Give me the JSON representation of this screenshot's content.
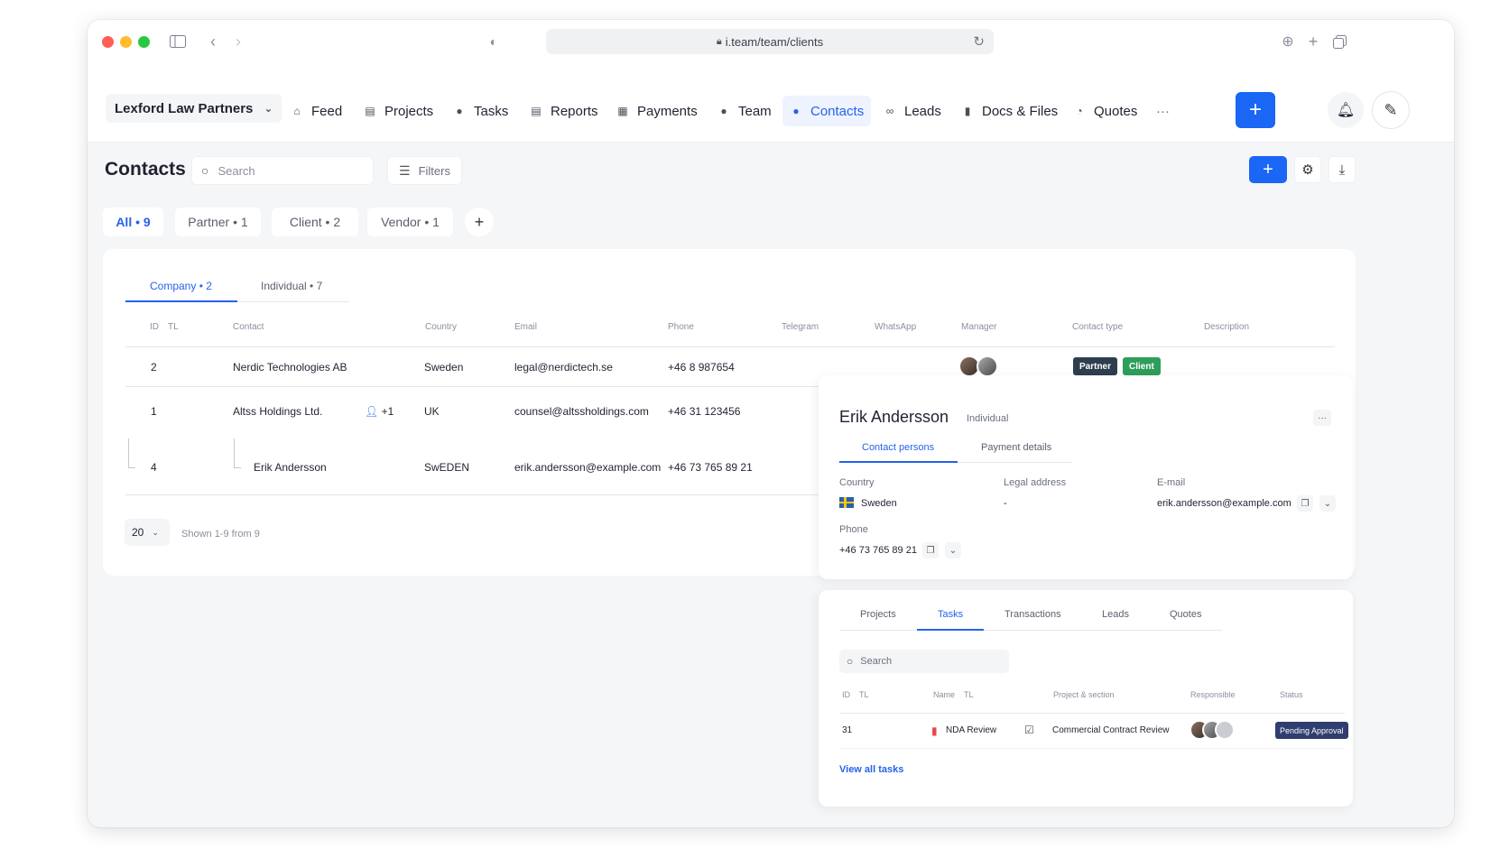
{
  "browser": {
    "url": "i.team/team/clients"
  },
  "org": {
    "name": "Lexford Law Partners"
  },
  "nav": [
    {
      "label": "Feed",
      "icon": "home-icon"
    },
    {
      "label": "Projects",
      "icon": "document-icon"
    },
    {
      "label": "Tasks",
      "icon": "check-circle-icon"
    },
    {
      "label": "Reports",
      "icon": "report-icon"
    },
    {
      "label": "Payments",
      "icon": "wallet-icon"
    },
    {
      "label": "Team",
      "icon": "user-icon"
    },
    {
      "label": "Contacts",
      "icon": "contacts-icon",
      "active": true
    },
    {
      "label": "Leads",
      "icon": "link-icon"
    },
    {
      "label": "Docs & Files",
      "icon": "folder-icon"
    },
    {
      "label": "Quotes",
      "icon": "quote-icon"
    }
  ],
  "nav_more": "···",
  "page": {
    "title": "Contacts",
    "search_placeholder": "Search",
    "filters_label": "Filters"
  },
  "pills": [
    {
      "label": "All • 9",
      "active": true
    },
    {
      "label": "Partner • 1"
    },
    {
      "label": "Client • 2"
    },
    {
      "label": "Vendor • 1"
    }
  ],
  "subtabs": [
    {
      "label": "Company • 2",
      "active": true
    },
    {
      "label": "Individual • 7"
    }
  ],
  "table": {
    "headers": {
      "id": "ID",
      "tl": "TL",
      "contact": "Contact",
      "country": "Country",
      "email": "Email",
      "phone": "Phone",
      "telegram": "Telegram",
      "whatsapp": "WhatsApp",
      "manager": "Manager",
      "contact_type": "Contact type",
      "description": "Description"
    },
    "rows": [
      {
        "id": "2",
        "contact": "Nerdic Technologies AB",
        "country": "Sweden",
        "email": "legal@nerdictech.se",
        "phone": "+46 8 987654",
        "types": [
          "Partner",
          "Client"
        ]
      },
      {
        "id": "1",
        "contact": "Altss Holdings Ltd.",
        "persons": "+1",
        "country": "UK",
        "email": "counsel@altssholdings.com",
        "phone": "+46 31 123456"
      },
      {
        "id": "4",
        "contact": "Erik Andersson",
        "country": "SwEDEN",
        "email": "erik.andersson@example.com",
        "phone": "+46 73 765 89 21"
      }
    ]
  },
  "pager": {
    "per_page": "20",
    "shown": "Shown 1-9 from 9"
  },
  "colors": {
    "accent": "#1a66f5",
    "partner": "#2f3e4e",
    "client": "#2e9e5b",
    "status": "#2f3e6e"
  },
  "detail": {
    "name": "Erik Andersson",
    "type": "Individual",
    "more": "···",
    "tabs": [
      {
        "label": "Contact persons",
        "active": true
      },
      {
        "label": "Payment details"
      }
    ],
    "country_label": "Country",
    "country": "Sweden",
    "legal_label": "Legal address",
    "legal": "-",
    "email_label": "E-mail",
    "email": "erik.andersson@example.com",
    "phone_label": "Phone",
    "phone": "+46 73 765 89 21"
  },
  "tasks": {
    "tabs": [
      {
        "label": "Projects"
      },
      {
        "label": "Tasks",
        "active": true
      },
      {
        "label": "Transactions"
      },
      {
        "label": "Leads"
      },
      {
        "label": "Quotes"
      }
    ],
    "search_placeholder": "Search",
    "headers": {
      "id": "ID",
      "tl": "TL",
      "name": "Name",
      "tl2": "TL",
      "project": "Project & section",
      "responsible": "Responsible",
      "status": "Status"
    },
    "rows": [
      {
        "id": "31",
        "name": "NDA Review",
        "project": "Commercial Contract Review",
        "status": "Pending Approval"
      }
    ],
    "view_all": "View all tasks"
  }
}
